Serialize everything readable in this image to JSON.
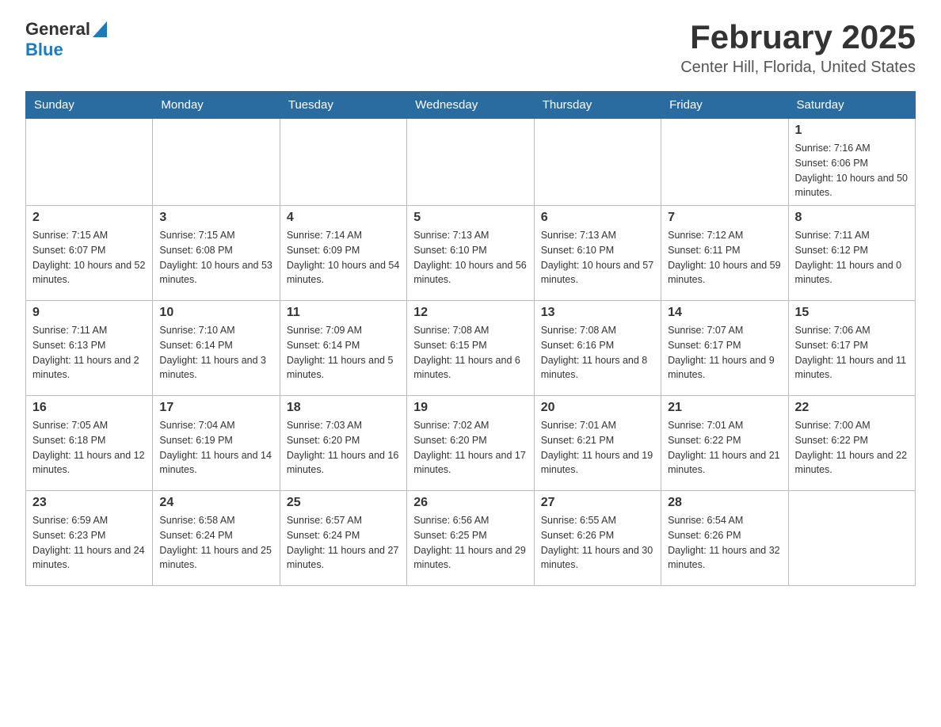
{
  "header": {
    "logo_general": "General",
    "logo_blue": "Blue",
    "title": "February 2025",
    "subtitle": "Center Hill, Florida, United States"
  },
  "days_of_week": [
    "Sunday",
    "Monday",
    "Tuesday",
    "Wednesday",
    "Thursday",
    "Friday",
    "Saturday"
  ],
  "weeks": [
    [
      {
        "day": "",
        "sunrise": "",
        "sunset": "",
        "daylight": ""
      },
      {
        "day": "",
        "sunrise": "",
        "sunset": "",
        "daylight": ""
      },
      {
        "day": "",
        "sunrise": "",
        "sunset": "",
        "daylight": ""
      },
      {
        "day": "",
        "sunrise": "",
        "sunset": "",
        "daylight": ""
      },
      {
        "day": "",
        "sunrise": "",
        "sunset": "",
        "daylight": ""
      },
      {
        "day": "",
        "sunrise": "",
        "sunset": "",
        "daylight": ""
      },
      {
        "day": "1",
        "sunrise": "Sunrise: 7:16 AM",
        "sunset": "Sunset: 6:06 PM",
        "daylight": "Daylight: 10 hours and 50 minutes."
      }
    ],
    [
      {
        "day": "2",
        "sunrise": "Sunrise: 7:15 AM",
        "sunset": "Sunset: 6:07 PM",
        "daylight": "Daylight: 10 hours and 52 minutes."
      },
      {
        "day": "3",
        "sunrise": "Sunrise: 7:15 AM",
        "sunset": "Sunset: 6:08 PM",
        "daylight": "Daylight: 10 hours and 53 minutes."
      },
      {
        "day": "4",
        "sunrise": "Sunrise: 7:14 AM",
        "sunset": "Sunset: 6:09 PM",
        "daylight": "Daylight: 10 hours and 54 minutes."
      },
      {
        "day": "5",
        "sunrise": "Sunrise: 7:13 AM",
        "sunset": "Sunset: 6:10 PM",
        "daylight": "Daylight: 10 hours and 56 minutes."
      },
      {
        "day": "6",
        "sunrise": "Sunrise: 7:13 AM",
        "sunset": "Sunset: 6:10 PM",
        "daylight": "Daylight: 10 hours and 57 minutes."
      },
      {
        "day": "7",
        "sunrise": "Sunrise: 7:12 AM",
        "sunset": "Sunset: 6:11 PM",
        "daylight": "Daylight: 10 hours and 59 minutes."
      },
      {
        "day": "8",
        "sunrise": "Sunrise: 7:11 AM",
        "sunset": "Sunset: 6:12 PM",
        "daylight": "Daylight: 11 hours and 0 minutes."
      }
    ],
    [
      {
        "day": "9",
        "sunrise": "Sunrise: 7:11 AM",
        "sunset": "Sunset: 6:13 PM",
        "daylight": "Daylight: 11 hours and 2 minutes."
      },
      {
        "day": "10",
        "sunrise": "Sunrise: 7:10 AM",
        "sunset": "Sunset: 6:14 PM",
        "daylight": "Daylight: 11 hours and 3 minutes."
      },
      {
        "day": "11",
        "sunrise": "Sunrise: 7:09 AM",
        "sunset": "Sunset: 6:14 PM",
        "daylight": "Daylight: 11 hours and 5 minutes."
      },
      {
        "day": "12",
        "sunrise": "Sunrise: 7:08 AM",
        "sunset": "Sunset: 6:15 PM",
        "daylight": "Daylight: 11 hours and 6 minutes."
      },
      {
        "day": "13",
        "sunrise": "Sunrise: 7:08 AM",
        "sunset": "Sunset: 6:16 PM",
        "daylight": "Daylight: 11 hours and 8 minutes."
      },
      {
        "day": "14",
        "sunrise": "Sunrise: 7:07 AM",
        "sunset": "Sunset: 6:17 PM",
        "daylight": "Daylight: 11 hours and 9 minutes."
      },
      {
        "day": "15",
        "sunrise": "Sunrise: 7:06 AM",
        "sunset": "Sunset: 6:17 PM",
        "daylight": "Daylight: 11 hours and 11 minutes."
      }
    ],
    [
      {
        "day": "16",
        "sunrise": "Sunrise: 7:05 AM",
        "sunset": "Sunset: 6:18 PM",
        "daylight": "Daylight: 11 hours and 12 minutes."
      },
      {
        "day": "17",
        "sunrise": "Sunrise: 7:04 AM",
        "sunset": "Sunset: 6:19 PM",
        "daylight": "Daylight: 11 hours and 14 minutes."
      },
      {
        "day": "18",
        "sunrise": "Sunrise: 7:03 AM",
        "sunset": "Sunset: 6:20 PM",
        "daylight": "Daylight: 11 hours and 16 minutes."
      },
      {
        "day": "19",
        "sunrise": "Sunrise: 7:02 AM",
        "sunset": "Sunset: 6:20 PM",
        "daylight": "Daylight: 11 hours and 17 minutes."
      },
      {
        "day": "20",
        "sunrise": "Sunrise: 7:01 AM",
        "sunset": "Sunset: 6:21 PM",
        "daylight": "Daylight: 11 hours and 19 minutes."
      },
      {
        "day": "21",
        "sunrise": "Sunrise: 7:01 AM",
        "sunset": "Sunset: 6:22 PM",
        "daylight": "Daylight: 11 hours and 21 minutes."
      },
      {
        "day": "22",
        "sunrise": "Sunrise: 7:00 AM",
        "sunset": "Sunset: 6:22 PM",
        "daylight": "Daylight: 11 hours and 22 minutes."
      }
    ],
    [
      {
        "day": "23",
        "sunrise": "Sunrise: 6:59 AM",
        "sunset": "Sunset: 6:23 PM",
        "daylight": "Daylight: 11 hours and 24 minutes."
      },
      {
        "day": "24",
        "sunrise": "Sunrise: 6:58 AM",
        "sunset": "Sunset: 6:24 PM",
        "daylight": "Daylight: 11 hours and 25 minutes."
      },
      {
        "day": "25",
        "sunrise": "Sunrise: 6:57 AM",
        "sunset": "Sunset: 6:24 PM",
        "daylight": "Daylight: 11 hours and 27 minutes."
      },
      {
        "day": "26",
        "sunrise": "Sunrise: 6:56 AM",
        "sunset": "Sunset: 6:25 PM",
        "daylight": "Daylight: 11 hours and 29 minutes."
      },
      {
        "day": "27",
        "sunrise": "Sunrise: 6:55 AM",
        "sunset": "Sunset: 6:26 PM",
        "daylight": "Daylight: 11 hours and 30 minutes."
      },
      {
        "day": "28",
        "sunrise": "Sunrise: 6:54 AM",
        "sunset": "Sunset: 6:26 PM",
        "daylight": "Daylight: 11 hours and 32 minutes."
      },
      {
        "day": "",
        "sunrise": "",
        "sunset": "",
        "daylight": ""
      }
    ]
  ]
}
